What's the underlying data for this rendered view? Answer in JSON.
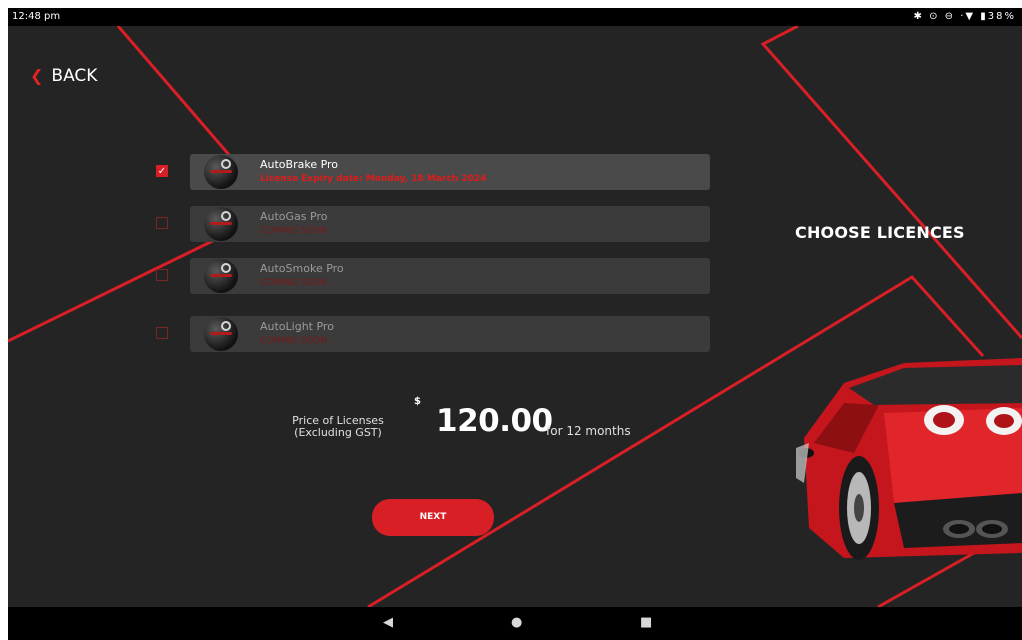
{
  "status_bar": {
    "time": "12:48 pm",
    "icons": "✱ ⊙ ⊖ ·▼ ▮38%"
  },
  "back": {
    "label": "BACK",
    "icon": "chevron-left-icon"
  },
  "title": "CHOOSE LICENCES",
  "licenses": [
    {
      "name": "AutoBrake Pro",
      "status": "License Expiry date: Monday, 18 March 2024",
      "checked": true
    },
    {
      "name": "AutoGas Pro",
      "status": "COMING SOON",
      "checked": false
    },
    {
      "name": "AutoSmoke Pro",
      "status": "COMING SOON",
      "checked": false
    },
    {
      "name": "AutoLight Pro",
      "status": "COMING SOON",
      "checked": false
    }
  ],
  "price": {
    "label_line1": "Price of Licenses",
    "label_line2": "(Excluding GST)",
    "currency": "$",
    "amount": "120.00",
    "period": "for 12 months"
  },
  "next_label": "NEXT",
  "colors": {
    "accent": "#d91f26",
    "background": "#242424",
    "row": "#3b3b3b"
  },
  "nav": {
    "back_icon": "triangle-back-icon",
    "home_icon": "circle-home-icon",
    "recents_icon": "square-recents-icon"
  }
}
